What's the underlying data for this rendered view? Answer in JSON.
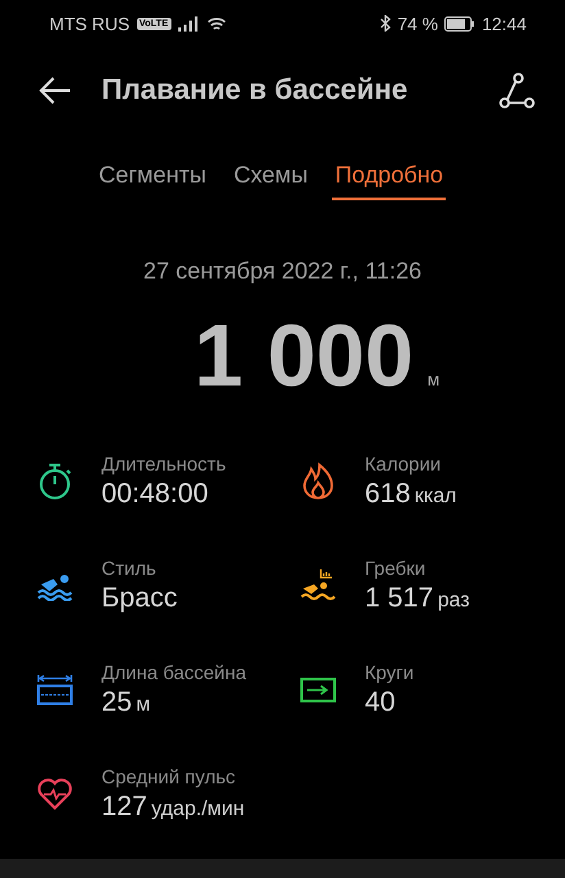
{
  "status_bar": {
    "carrier": "MTS RUS",
    "volte": "VoLTE",
    "battery": "74 %",
    "time": "12:44"
  },
  "header": {
    "title": "Плавание в бассейне"
  },
  "tabs": [
    {
      "label": "Сегменты",
      "selected": false
    },
    {
      "label": "Схемы",
      "selected": false
    },
    {
      "label": "Подробно",
      "selected": true
    }
  ],
  "summary": {
    "date": "27 сентября 2022 г., 11:26",
    "distance": "1 000",
    "unit": "м"
  },
  "metrics": [
    {
      "kind": "duration",
      "label": "Длительность",
      "value": "00:48:00"
    },
    {
      "kind": "calories",
      "label": "Калории",
      "value": "618",
      "unit": "ккал"
    },
    {
      "kind": "style",
      "label": "Стиль",
      "value": "Брасс"
    },
    {
      "kind": "strokes",
      "label": "Гребки",
      "value": "1 517",
      "unit": "раз"
    },
    {
      "kind": "pool",
      "label": "Длина бассейна",
      "value": "25",
      "unit": "м"
    },
    {
      "kind": "laps",
      "label": "Круги",
      "value": "40"
    },
    {
      "kind": "heart",
      "label": "Средний пульс",
      "value": "127",
      "unit": "удар./мин"
    }
  ]
}
